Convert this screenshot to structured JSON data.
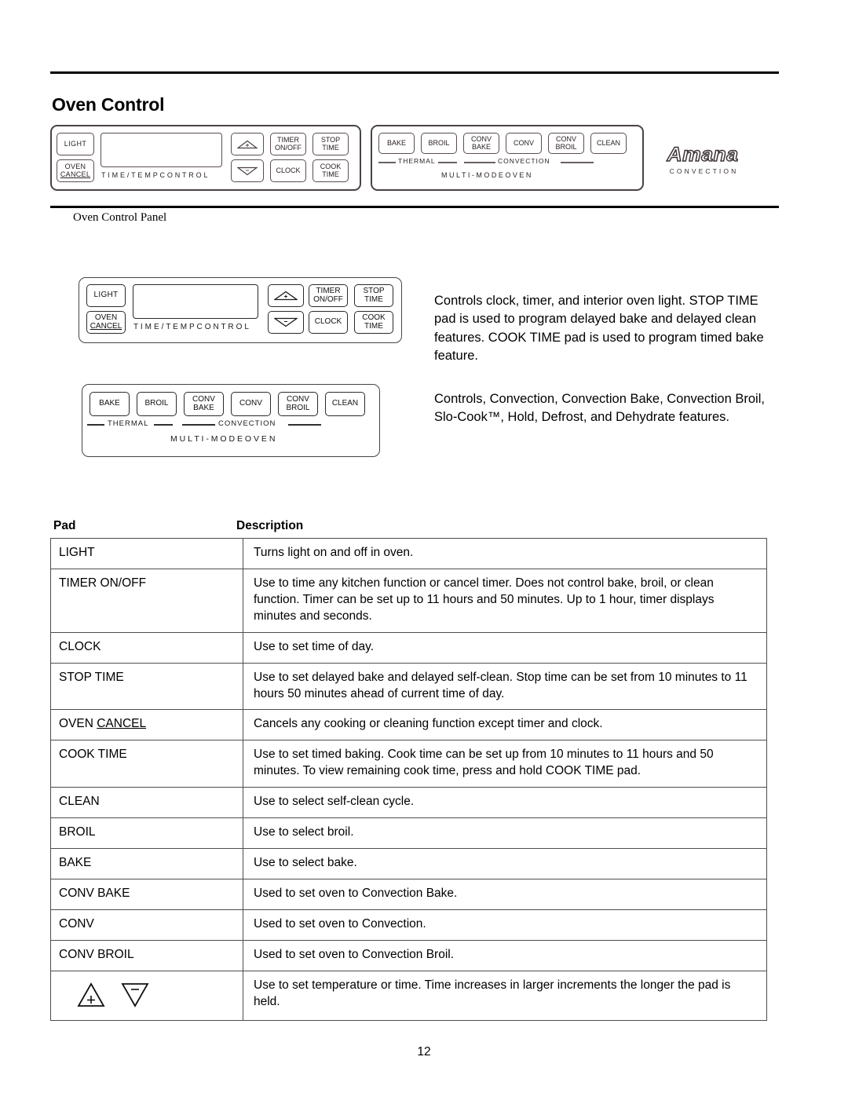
{
  "page": {
    "title": "Oven Control",
    "caption": "Oven Control Panel",
    "page_number": "12"
  },
  "control_panel_top": {
    "left_module": {
      "light_pad": "LIGHT",
      "oven_cancel_line1": "OVEN",
      "oven_cancel_line2": "CANCEL",
      "display_label": "T I M E / T E M P   C O N T R O L",
      "up_arrow_icon": "triangle-up-plus",
      "down_arrow_icon": "triangle-down-minus",
      "timer_line1": "TIMER",
      "timer_line2": "ON/OFF",
      "stop_line1": "STOP",
      "stop_line2": "TIME",
      "clock_pad": "CLOCK",
      "cook_line1": "COOK",
      "cook_line2": "TIME"
    },
    "right_module": {
      "bake": "BAKE",
      "broil": "BROIL",
      "conv_bake_line1": "CONV",
      "conv_bake_line2": "BAKE",
      "conv": "CONV",
      "conv_broil_line1": "CONV",
      "conv_broil_line2": "BROIL",
      "clean": "CLEAN",
      "thermal_label": "THERMAL",
      "convection_label": "CONVECTION",
      "multimode_label": "M U L T I - M O D E   O V E N"
    },
    "brand": {
      "wordmark": "Amana",
      "subtitle": "CONVECTION"
    }
  },
  "figure_time_temp": {
    "light_pad": "LIGHT",
    "oven_cancel_line1": "OVEN",
    "oven_cancel_line2": "CANCEL",
    "display_label": "T I M E / T E M P   C O N T R O L",
    "up_arrow_icon": "triangle-up-plus",
    "down_arrow_icon": "triangle-down-minus",
    "timer_line1": "TIMER",
    "timer_line2": "ON/OFF",
    "stop_line1": "STOP",
    "stop_line2": "TIME",
    "clock_pad": "CLOCK",
    "cook_line1": "COOK",
    "cook_line2": "TIME",
    "description": "Controls clock, timer, and interior oven light. STOP TIME pad is used to program delayed bake and delayed clean features. COOK TIME pad is used to program timed bake feature."
  },
  "figure_multimode": {
    "bake": "BAKE",
    "broil": "BROIL",
    "conv_bake_line1": "CONV",
    "conv_bake_line2": "BAKE",
    "conv": "CONV",
    "conv_broil_line1": "CONV",
    "conv_broil_line2": "BROIL",
    "clean": "CLEAN",
    "thermal_label": "THERMAL",
    "convection_label": "CONVECTION",
    "multimode_label": "M U L T I - M O D E   O V E N",
    "description": "Controls, Convection, Convection Bake, Convection Broil, Slo-Cook™, Hold, Defrost, and Dehydrate features."
  },
  "table": {
    "header_pad": "Pad",
    "header_description": "Description",
    "rows": [
      {
        "pad": "LIGHT",
        "description": "Turns light on and off in oven."
      },
      {
        "pad": "TIMER ON/OFF",
        "description": "Use to time any kitchen function or cancel timer. Does not control bake, broil, or clean function. Timer can be set up to 11 hours and 50 minutes. Up to 1 hour, timer displays minutes and seconds."
      },
      {
        "pad": "CLOCK",
        "description": "Use to set time of day."
      },
      {
        "pad": "STOP TIME",
        "description": "Use to set delayed bake and delayed self-clean. Stop time can be set from 10 minutes to 11 hours 50 minutes ahead of current time of day."
      },
      {
        "pad": "OVEN CANCEL",
        "pad_prefix": "OVEN ",
        "pad_underlined": "CANCEL",
        "description": "Cancels any cooking or cleaning function except timer and clock."
      },
      {
        "pad": "COOK TIME",
        "description": "Use to set timed baking. Cook time can be set up from 10 minutes to 11 hours and 50 minutes. To view remaining cook time, press and hold COOK TIME pad."
      },
      {
        "pad": "CLEAN",
        "description": "Use to select self-clean cycle."
      },
      {
        "pad": "BROIL",
        "description": "Use to select broil."
      },
      {
        "pad": "BAKE",
        "description": "Use to select bake."
      },
      {
        "pad": "CONV BAKE",
        "description": "Used to set oven to Convection Bake."
      },
      {
        "pad": "CONV",
        "description": "Used to set oven to Convection."
      },
      {
        "pad": "CONV BROIL",
        "description": "Used to set oven to Convection Broil."
      },
      {
        "pad": "",
        "pad_icons": [
          "triangle-up-plus",
          "triangle-down-minus"
        ],
        "description": "Use to set temperature or time. Time increases in larger increments the longer the pad is held."
      }
    ]
  }
}
